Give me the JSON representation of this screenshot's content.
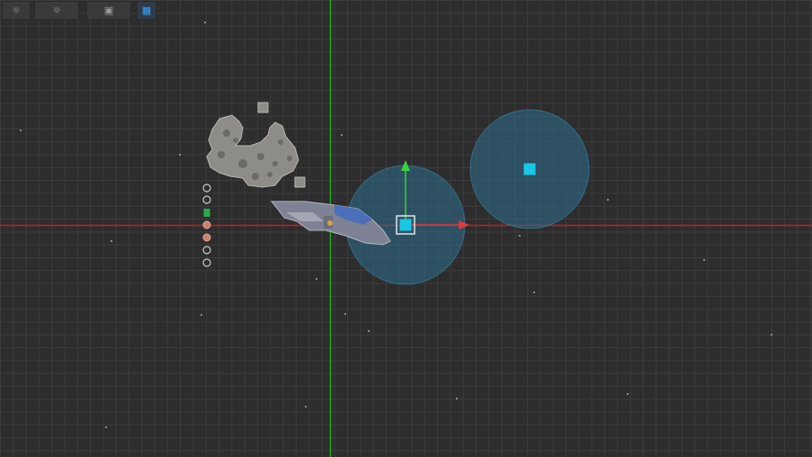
{
  "toolbar": {
    "buttons": [
      {
        "name": "sun-light-icon",
        "glyph": "☼"
      },
      {
        "name": "environment-light-icon",
        "glyph": "☼"
      },
      {
        "name": "camera-icon",
        "glyph": "▣"
      },
      {
        "name": "grid-view-icon",
        "glyph": "▦"
      }
    ]
  },
  "colors": {
    "background": "#2d2d2d",
    "grid": "#3c3c3c",
    "x_axis": "#c21f1f",
    "y_axis": "#17b017",
    "light_radius": "#2e6f8f",
    "light_icon": "#19c7e6",
    "gizmo_y": "#3ad13a",
    "gizmo_x": "#e13a3a"
  },
  "scene": {
    "objects": [
      {
        "name": "rock-cluster-sprite"
      },
      {
        "name": "spaceship-sprite"
      },
      {
        "name": "point-light-selected"
      },
      {
        "name": "point-light-secondary"
      }
    ]
  }
}
